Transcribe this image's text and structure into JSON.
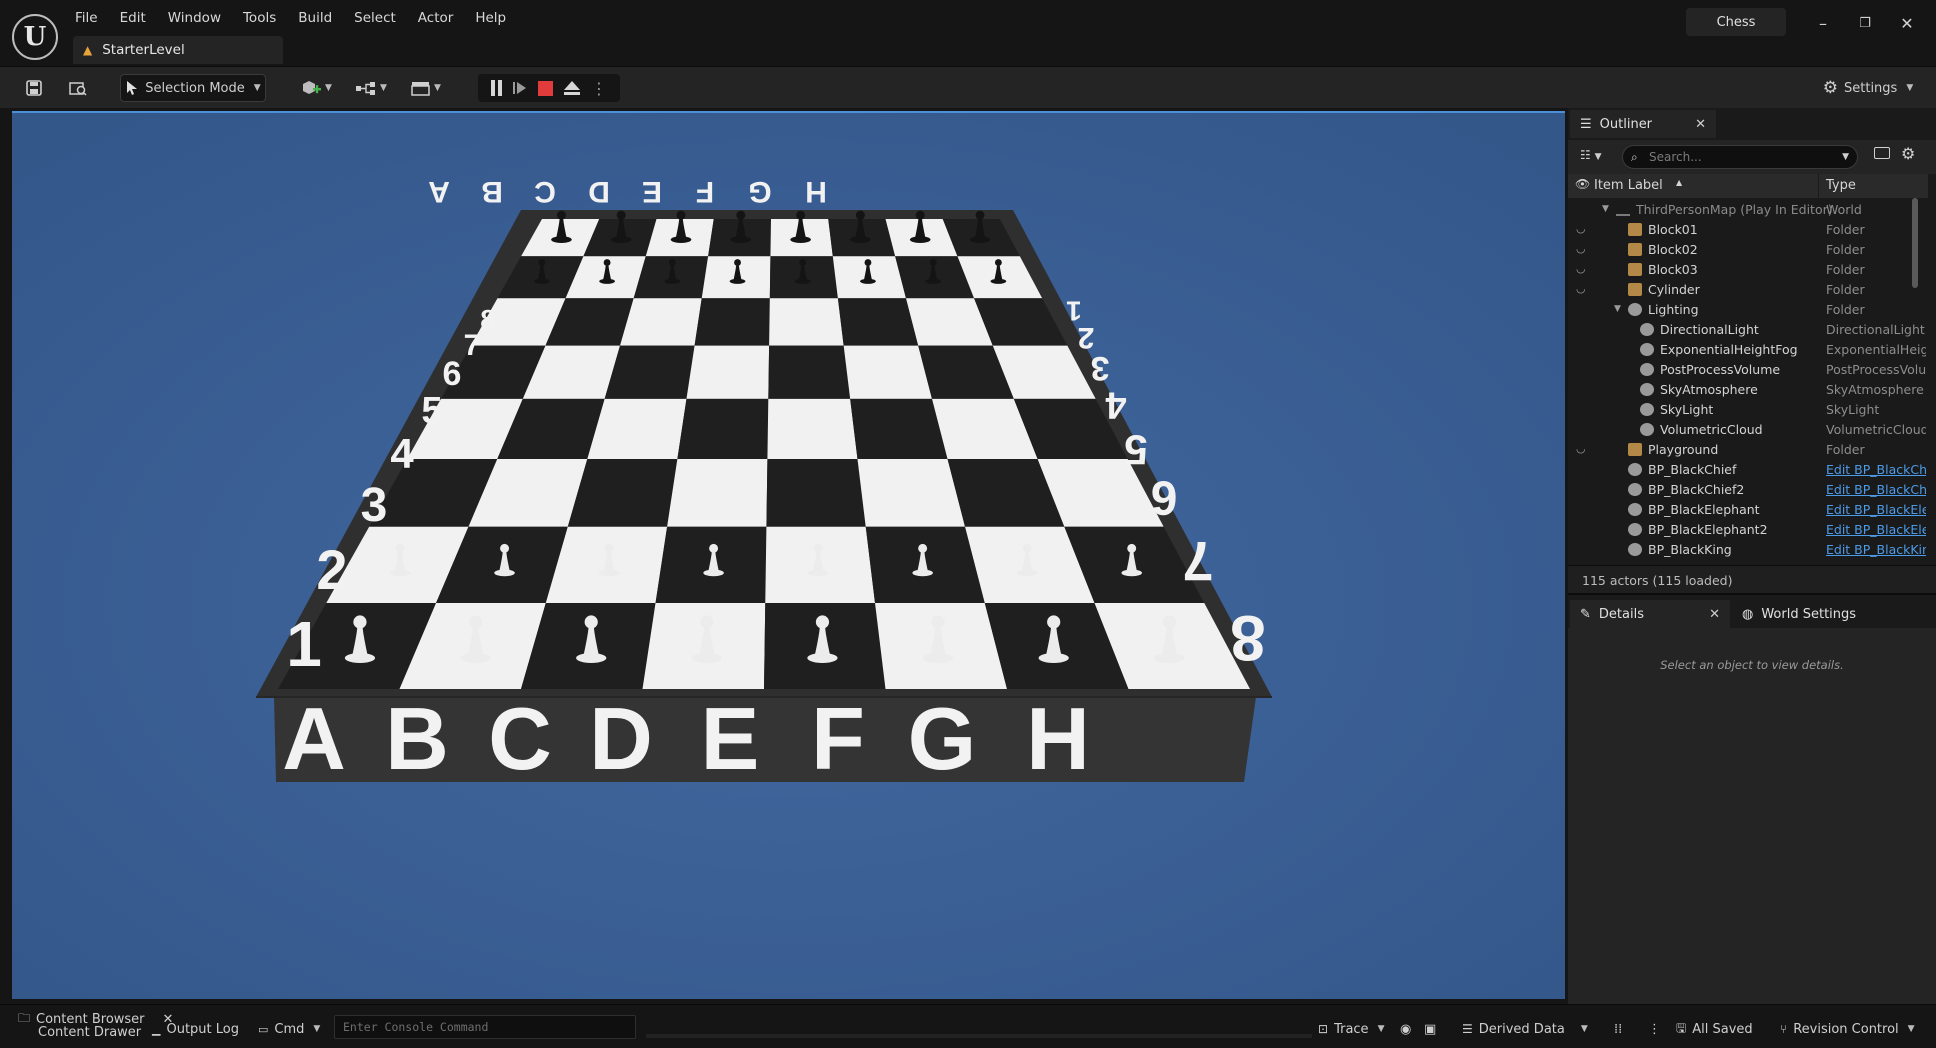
{
  "app": {
    "level_name": "StarterLevel",
    "project_name": "Chess"
  },
  "menu": [
    "File",
    "Edit",
    "Window",
    "Tools",
    "Build",
    "Select",
    "Actor",
    "Help"
  ],
  "toolbar": {
    "selection_mode": "Selection Mode",
    "settings": "Settings"
  },
  "viewport": {
    "board_files_front": [
      "A",
      "B",
      "C",
      "D",
      "E",
      "F",
      "G",
      "H"
    ],
    "board_files_back": [
      "H",
      "G",
      "F",
      "E",
      "D",
      "C",
      "B",
      "A"
    ],
    "board_ranks_left": [
      "1",
      "2",
      "3",
      "4",
      "5",
      "6",
      "7",
      "8"
    ],
    "board_ranks_right": [
      "8",
      "7",
      "6",
      "5",
      "4",
      "3",
      "2",
      "1"
    ],
    "colors": {
      "sky": "#395d93",
      "board_frame": "#3a3a3a",
      "dark_square": "#1f1f1f",
      "light_square": "#f1f1f1"
    }
  },
  "outliner": {
    "tab_label": "Outliner",
    "search_placeholder": "Search...",
    "columns": {
      "label": "Item Label",
      "type": "Type"
    },
    "rows": [
      {
        "label": "ThirdPersonMap (Play In Editor)",
        "type": "World",
        "kind": "world"
      },
      {
        "label": "Block01",
        "type": "Folder",
        "kind": "folder"
      },
      {
        "label": "Block02",
        "type": "Folder",
        "kind": "folder"
      },
      {
        "label": "Block03",
        "type": "Folder",
        "kind": "folder"
      },
      {
        "label": "Cylinder",
        "type": "Folder",
        "kind": "folder"
      },
      {
        "label": "Lighting",
        "type": "Folder",
        "kind": "folder-open"
      },
      {
        "label": "DirectionalLight",
        "type": "DirectionalLight",
        "kind": "light"
      },
      {
        "label": "ExponentialHeightFog",
        "type": "ExponentialHeightFog",
        "kind": "fog"
      },
      {
        "label": "PostProcessVolume",
        "type": "PostProcessVolume",
        "kind": "volume"
      },
      {
        "label": "SkyAtmosphere",
        "type": "SkyAtmosphere",
        "kind": "sky"
      },
      {
        "label": "SkyLight",
        "type": "SkyLight",
        "kind": "skylight"
      },
      {
        "label": "VolumetricCloud",
        "type": "VolumetricCloud",
        "kind": "cloud"
      },
      {
        "label": "Playground",
        "type": "Folder",
        "kind": "folder"
      },
      {
        "label": "BP_BlackChief",
        "type": "Edit BP_BlackChief",
        "kind": "bp"
      },
      {
        "label": "BP_BlackChief2",
        "type": "Edit BP_BlackChief",
        "kind": "bp"
      },
      {
        "label": "BP_BlackElephant",
        "type": "Edit BP_BlackElephant",
        "kind": "bp"
      },
      {
        "label": "BP_BlackElephant2",
        "type": "Edit BP_BlackElephant",
        "kind": "bp"
      },
      {
        "label": "BP_BlackKing",
        "type": "Edit BP_BlackKing",
        "kind": "bp"
      }
    ],
    "actor_count": "115 actors (115 loaded)"
  },
  "details": {
    "tab_label": "Details",
    "world_settings_label": "World Settings",
    "empty_hint": "Select an object to view details."
  },
  "statusbar": {
    "content_browser": "Content Browser",
    "content_drawer": "Content Drawer",
    "output_log": "Output Log",
    "cmd": "Cmd",
    "console_placeholder": "Enter Console Command",
    "trace": "Trace",
    "derived_data": "Derived Data",
    "all_saved": "All Saved",
    "revision_control": "Revision Control"
  }
}
